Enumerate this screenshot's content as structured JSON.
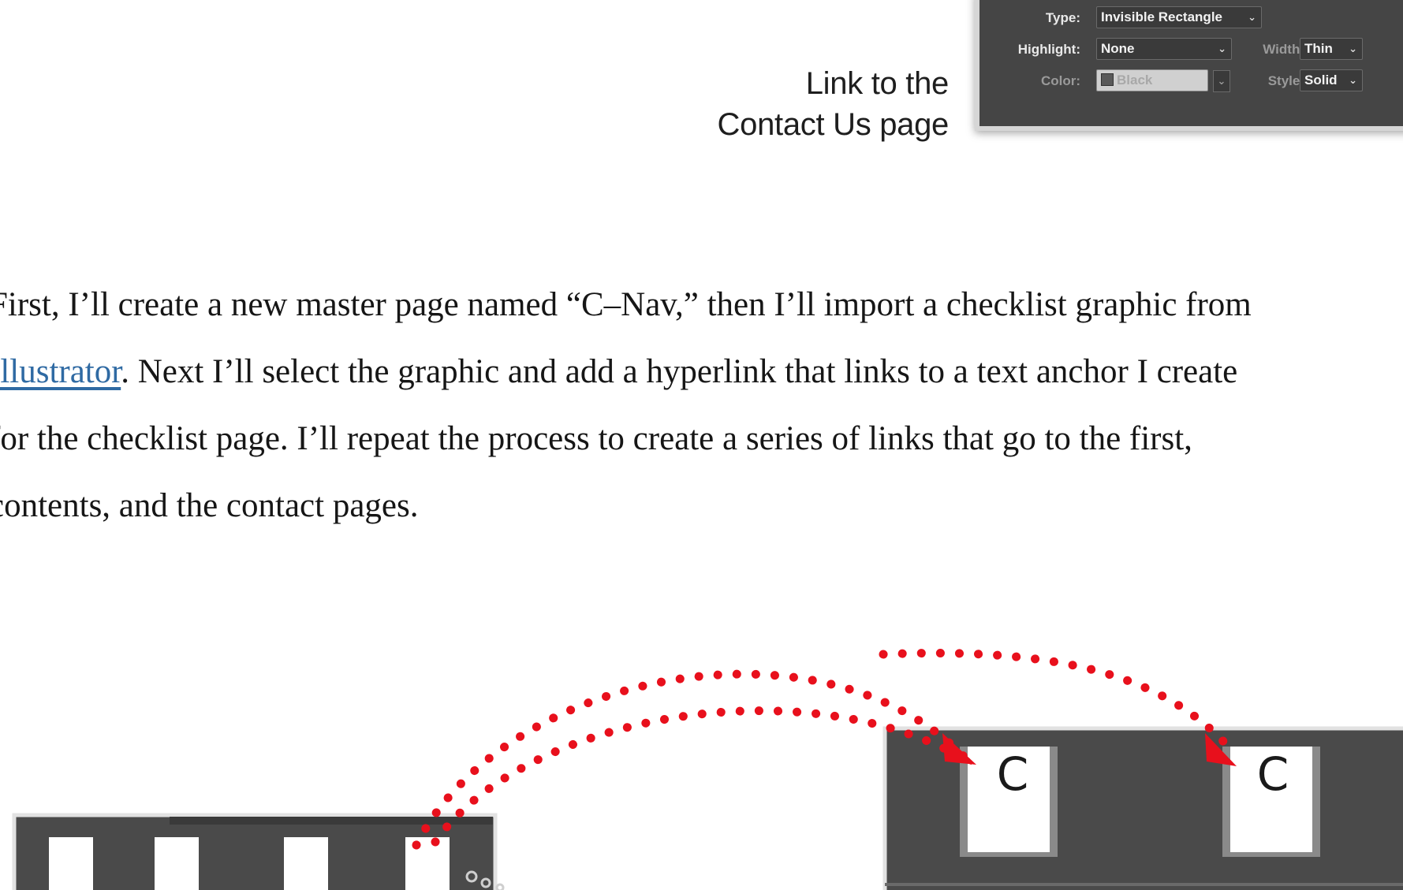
{
  "figure_top": {
    "caption": {
      "line1": "Link to the",
      "line2": "Contact Us page"
    },
    "panel": {
      "type": {
        "label": "Type:",
        "value": "Invisible Rectangle"
      },
      "highlight": {
        "label": "Highlight:",
        "value": "None"
      },
      "width": {
        "label": "Width:",
        "value": "Thin"
      },
      "color": {
        "label": "Color:",
        "value": "Black"
      },
      "style": {
        "label": "Style:",
        "value": "Solid"
      }
    }
  },
  "paragraph": {
    "line1": "First, I’ll create a new master page named “C–Nav,” then I’ll import a checklist graphic from",
    "line2_link": "Illustrator",
    "line2_rest": ". Next I’ll select the graphic and add a hyperlink that links to a text anchor I create",
    "line3": "for the checklist page. I’ll repeat the process to create a series of links that go to the first,",
    "line4": "contents, and the contact pages."
  },
  "diagram": {
    "page_letter_1": "C",
    "page_letter_2": "C",
    "colors": {
      "arrow": "#e8101c",
      "panel": "#4a4a4a",
      "page": "#ffffff"
    }
  }
}
